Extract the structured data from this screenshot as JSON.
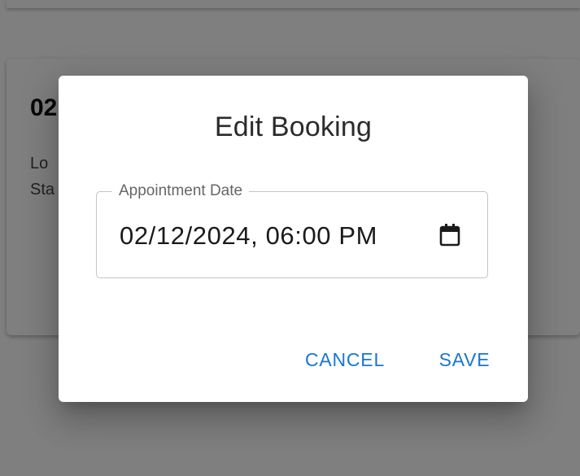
{
  "background": {
    "card_title": "02",
    "card_line1": "Lo",
    "card_line2": "Sta"
  },
  "dialog": {
    "title": "Edit Booking",
    "field": {
      "label": "Appointment Date",
      "value": "02/12/2024, 06:00 PM",
      "icon": "calendar-icon"
    },
    "actions": {
      "cancel_label": "CANCEL",
      "save_label": "SAVE"
    }
  },
  "colors": {
    "primary": "#1976d2",
    "overlay": "rgba(0,0,0,0.5)",
    "title_text": "#2b2b2b"
  }
}
